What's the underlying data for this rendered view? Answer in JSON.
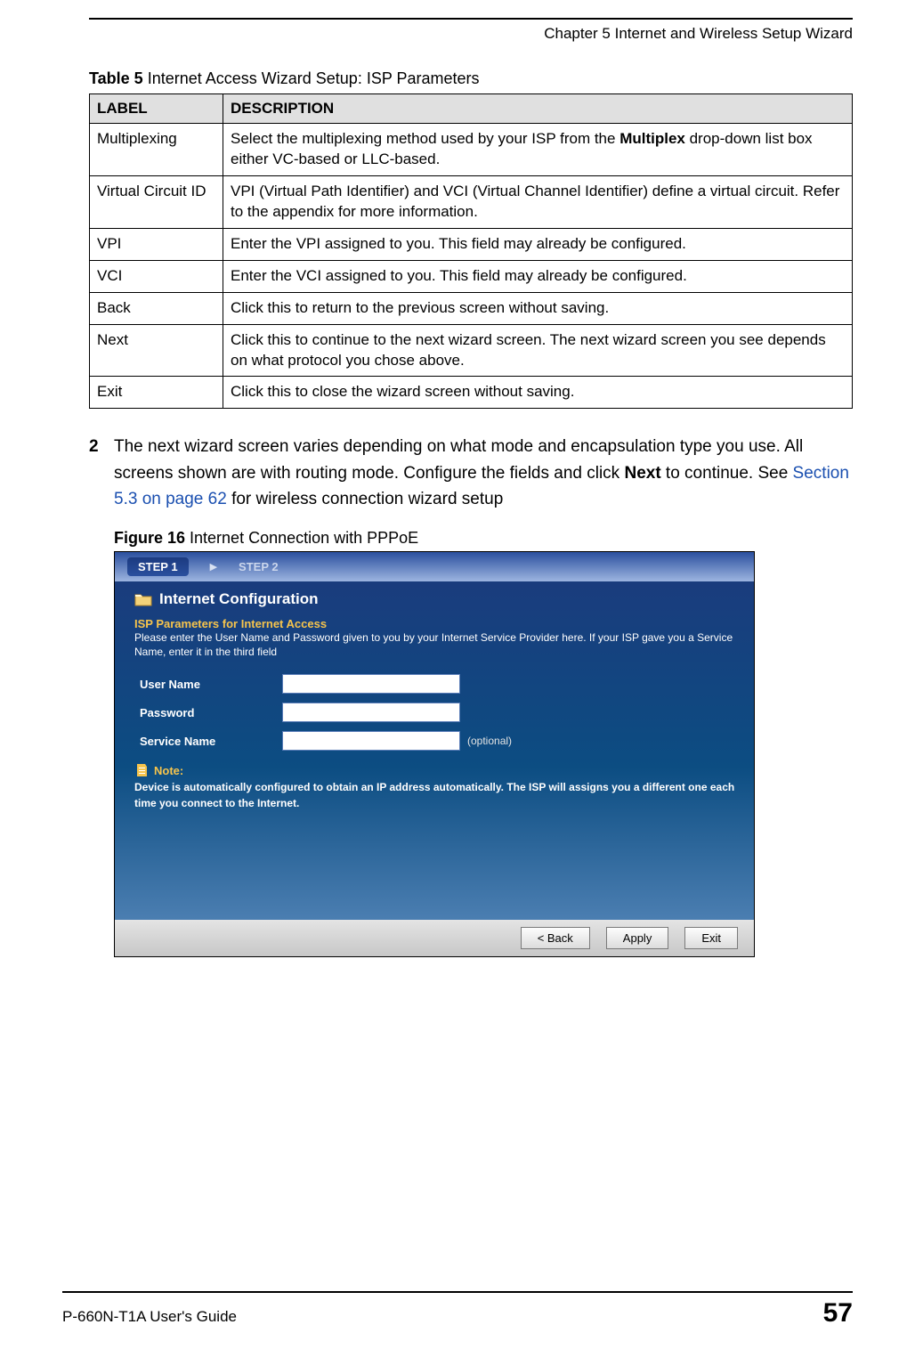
{
  "header": {
    "chapter": "Chapter 5 Internet and Wireless Setup Wizard"
  },
  "table": {
    "caption_bold": "Table 5",
    "caption_rest": "   Internet Access Wizard Setup: ISP Parameters",
    "col1": "LABEL",
    "col2": "DESCRIPTION",
    "rows": [
      {
        "label": "Multiplexing",
        "desc_pre": "Select the multiplexing method used by your ISP from the ",
        "desc_bold": "Multiplex",
        "desc_post": " drop-down list box either VC-based or LLC-based."
      },
      {
        "label": "Virtual Circuit ID",
        "desc": "VPI (Virtual Path Identifier) and VCI (Virtual Channel Identifier) define a virtual circuit. Refer to the appendix for more information."
      },
      {
        "label": "VPI",
        "desc": "Enter the VPI assigned to you. This field may already be configured."
      },
      {
        "label": "VCI",
        "desc": "Enter the VCI assigned to you. This field may already be configured."
      },
      {
        "label": "Back",
        "desc": "Click this to return to the previous screen without saving."
      },
      {
        "label": "Next",
        "desc": "Click this to continue to the next wizard screen. The next wizard screen you see depends on what protocol you chose above."
      },
      {
        "label": "Exit",
        "desc": "Click this to close the wizard screen without saving."
      }
    ]
  },
  "para": {
    "num": "2",
    "t1": "The next wizard screen varies depending on what mode and encapsulation type you use. All screens shown are with routing mode. Configure the fields and click ",
    "bold": "Next",
    "t2": " to continue. See ",
    "link": "Section 5.3 on page 62",
    "t3": " for wireless connection wizard setup"
  },
  "figure": {
    "caption_bold": "Figure 16",
    "caption_rest": "   Internet Connection with PPPoE"
  },
  "wizard": {
    "step1": "STEP 1",
    "step2": "STEP 2",
    "title": "Internet Configuration",
    "sub": "ISP Parameters for Internet Access",
    "desc": "Please enter the User Name and Password given to you by your Internet Service Provider here. If your ISP gave you a Service Name, enter it in the third field",
    "labels": {
      "user": "User Name",
      "pass": "Password",
      "service": "Service Name"
    },
    "optional": "(optional)",
    "note_head": "Note:",
    "note": "Device is automatically configured to obtain an IP address automatically. The ISP will assigns you a different one each time you connect to the Internet.",
    "buttons": {
      "back": "< Back",
      "apply": "Apply",
      "exit": "Exit"
    }
  },
  "footer": {
    "guide": "P-660N-T1A User's Guide",
    "page": "57"
  }
}
